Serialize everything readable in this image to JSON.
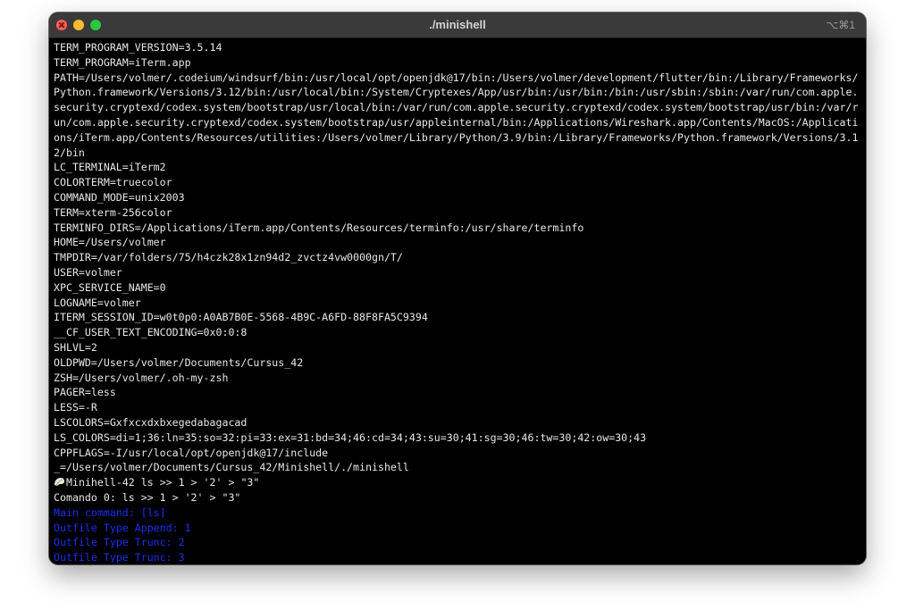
{
  "window": {
    "title": "./minishell",
    "shortcut": "⌥⌘1"
  },
  "terminal": {
    "lines": [
      "TERM_PROGRAM_VERSION=3.5.14",
      "TERM_PROGRAM=iTerm.app",
      "PATH=/Users/volmer/.codeium/windsurf/bin:/usr/local/opt/openjdk@17/bin:/Users/volmer/development/flutter/bin:/Library/Frameworks/Python.framework/Versions/3.12/bin:/usr/local/bin:/System/Cryptexes/App/usr/bin:/usr/bin:/bin:/usr/sbin:/sbin:/var/run/com.apple.security.cryptexd/codex.system/bootstrap/usr/local/bin:/var/run/com.apple.security.cryptexd/codex.system/bootstrap/usr/bin:/var/run/com.apple.security.cryptexd/codex.system/bootstrap/usr/appleinternal/bin:/Applications/Wireshark.app/Contents/MacOS:/Applications/iTerm.app/Contents/Resources/utilities:/Users/volmer/Library/Python/3.9/bin:/Library/Frameworks/Python.framework/Versions/3.12/bin",
      "LC_TERMINAL=iTerm2",
      "COLORTERM=truecolor",
      "COMMAND_MODE=unix2003",
      "TERM=xterm-256color",
      "TERMINFO_DIRS=/Applications/iTerm.app/Contents/Resources/terminfo:/usr/share/terminfo",
      "HOME=/Users/volmer",
      "TMPDIR=/var/folders/75/h4czk28x1zn94d2_zvctz4vw0000gn/T/",
      "USER=volmer",
      "XPC_SERVICE_NAME=0",
      "LOGNAME=volmer",
      "ITERM_SESSION_ID=w0t0p0:A0AB7B0E-5568-4B9C-A6FD-88F8FA5C9394",
      "__CF_USER_TEXT_ENCODING=0x0:0:8",
      "SHLVL=2",
      "OLDPWD=/Users/volmer/Documents/Cursus_42",
      "ZSH=/Users/volmer/.oh-my-zsh",
      "PAGER=less",
      "LESS=-R",
      "LSCOLORS=Gxfxcxdxbxegedabagacad",
      "LS_COLORS=di=1;36:ln=35:so=32:pi=33:ex=31:bd=34;46:cd=34;43:su=30;41:sg=30;46:tw=30;42:ow=30;43",
      "CPPFLAGS=-I/usr/local/opt/openjdk@17/include",
      "_=/Users/volmer/Documents/Cursus_42/Minishell/./minishell"
    ],
    "prompt": "Minihell-42",
    "command": " ls >> 1 > '2' > \"3\"",
    "echo_line": "Comando 0: ls >> 1 > '2' > \"3\"",
    "debug_lines": [
      "Main command: [ls]",
      "Outfile Type Append: 1",
      "Outfile Type Trunc: 2",
      "Outfile Type Trunc: 3"
    ],
    "debug_color": "#1a2ef0"
  }
}
